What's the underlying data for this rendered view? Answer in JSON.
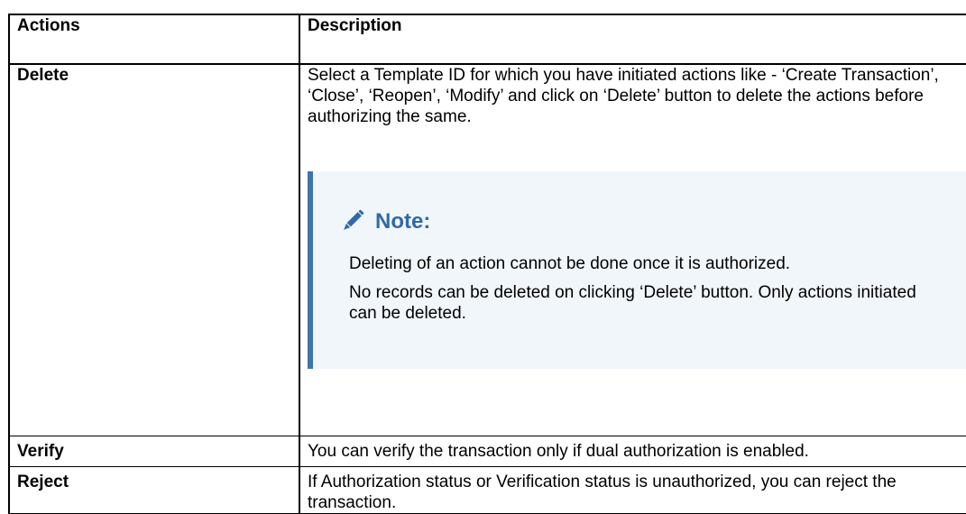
{
  "table": {
    "headers": {
      "actions": "Actions",
      "description": "Description"
    },
    "rows": [
      {
        "action": "Delete",
        "description": "Select a Template ID for which you have initiated actions like - ‘Create Transaction’, ‘Close’, ‘Reopen’, ‘Modify’ and click on ‘Delete’ button to delete the actions before authorizing the same.",
        "note": {
          "title": "Note:",
          "icon": "pencil-icon",
          "lines": [
            "Deleting of an action cannot be done once it is authorized.",
            "No records can be deleted on clicking ‘Delete’ button. Only actions initiated can be deleted."
          ]
        }
      },
      {
        "action": "Verify",
        "description": "You can verify the transaction only if dual authorization is enabled."
      },
      {
        "action": "Reject",
        "description": "If Authorization status or Verification status is unauthorized, you can reject the transaction."
      }
    ]
  },
  "colors": {
    "note_accent": "#3f74ad",
    "note_title": "#2f6aa8",
    "note_background": "#f1f6fb"
  }
}
